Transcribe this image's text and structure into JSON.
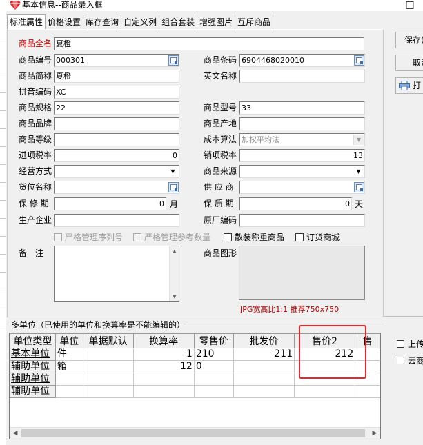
{
  "window": {
    "title": "基本信息--商品录入框",
    "close_glyph": "□"
  },
  "tabs": [
    "标准属性",
    "价格设置",
    "库存查询",
    "自定义列",
    "组合套装",
    "增强图片",
    "互斥商品"
  ],
  "labels": {
    "full_name": "商品全名",
    "code": "商品编号",
    "barcode": "商品条码",
    "short_name": "商品简称",
    "english_name": "英文名称",
    "pinyin": "拼音编码",
    "spec": "商品规格",
    "model": "商品型号",
    "brand": "商品品牌",
    "origin": "商品产地",
    "grade": "商品等级",
    "cost_method": "成本算法",
    "input_tax": "进项税率",
    "output_tax": "销项税率",
    "business_mode": "经营方式",
    "source": "商品来源",
    "location": "货位名称",
    "supplier": "供 应 商",
    "warranty": "保 修 期",
    "shelf_life": "保 质 期",
    "manufacturer": "生产企业",
    "factory_code": "原厂编码",
    "note": "备　注",
    "image": "商品图形"
  },
  "values": {
    "full_name": "夏橙",
    "code": "000301",
    "barcode": "6904468020010",
    "short_name": "夏橙",
    "english_name": "",
    "pinyin": "XC",
    "spec": "22",
    "model": "33",
    "brand": "",
    "origin": "",
    "grade": "",
    "cost_method": "加权平均法",
    "input_tax": "0",
    "output_tax": "13",
    "business_mode": "",
    "source": "",
    "location": "",
    "supplier": "",
    "warranty": "0",
    "shelf_life": "0",
    "manufacturer": "",
    "factory_code": ""
  },
  "units": {
    "warranty": "月",
    "shelf_life": "天"
  },
  "checkboxes": [
    "严格管理序列号",
    "严格管理参考数量",
    "散装称重商品",
    "订货商城"
  ],
  "image_hint": "JPG宽高比1:1 推荐750x750",
  "multi_unit": {
    "caption": "多单位（已使用的单位和换算率是不能编辑的）",
    "columns": [
      "单位类型",
      "单位",
      "单据默认",
      "换算率",
      "零售价",
      "批发价",
      "售价2",
      "售"
    ],
    "rows": [
      [
        "基本单位",
        "件",
        "",
        "1",
        "210",
        "211",
        "212",
        ""
      ],
      [
        "辅助单位",
        "箱",
        "",
        "12",
        "0",
        "",
        "",
        ""
      ],
      [
        "辅助单位",
        "",
        "",
        "",
        "",
        "",
        "",
        ""
      ],
      [
        "辅助单位",
        "",
        "",
        "",
        "",
        "",
        "",
        ""
      ]
    ]
  },
  "side": {
    "save": "保存(",
    "cancel": "取消",
    "print": "打",
    "upload": "上传",
    "cloud": "云商"
  },
  "colors": {
    "required_label": "#cc0000",
    "hint": "#b00000",
    "highlight": "#e8262b"
  }
}
